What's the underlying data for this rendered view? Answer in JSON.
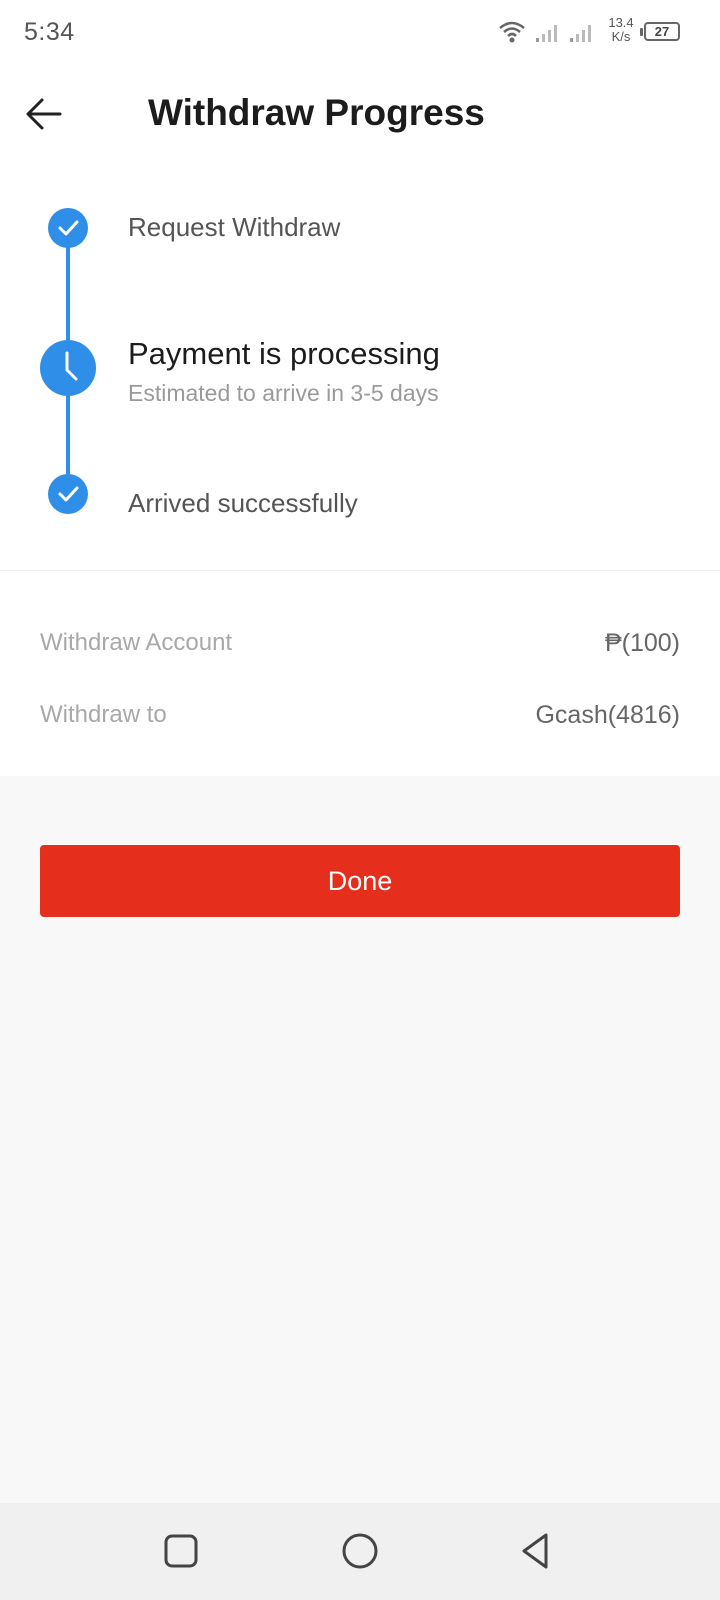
{
  "status_bar": {
    "time": "5:34",
    "net_speed_value": "13.4",
    "net_speed_unit": "K/s",
    "battery": "27",
    "icons": [
      "wifi-icon",
      "signal-icon",
      "signal-icon",
      "battery-icon"
    ]
  },
  "header": {
    "title": "Withdraw Progress",
    "back_icon": "arrow-left-icon"
  },
  "timeline": {
    "accent_color": "#2f8ee8",
    "steps": [
      {
        "label": "Request Withdraw",
        "icon": "check-icon"
      },
      {
        "label": "Payment is processing",
        "sublabel": "Estimated to arrive in 3-5 days",
        "icon": "clock-icon"
      },
      {
        "label": "Arrived successfully",
        "icon": "check-icon"
      }
    ]
  },
  "details": {
    "rows": [
      {
        "label": "Withdraw Account",
        "value": "₱(100)"
      },
      {
        "label": "Withdraw to",
        "value": "Gcash(4816)"
      }
    ]
  },
  "done_button": {
    "label": "Done",
    "color": "#e52f1c"
  },
  "nav_bar": {
    "icons": [
      "recent-apps-icon",
      "home-icon",
      "back-icon"
    ]
  }
}
